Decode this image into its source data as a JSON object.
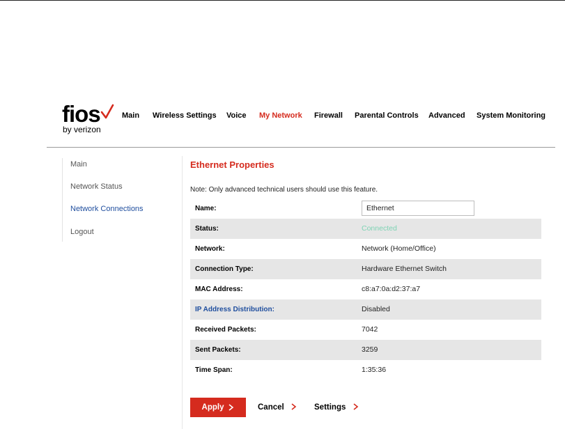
{
  "brand": {
    "logo_word": "fios",
    "logo_sub": "by verizon",
    "accent_color": "#d52b1e"
  },
  "top_nav": [
    {
      "label": "Main",
      "active": false
    },
    {
      "label": "Wireless Settings",
      "active": false
    },
    {
      "label": "Voice",
      "active": false
    },
    {
      "label": "My Network",
      "active": true
    },
    {
      "label": "Firewall",
      "active": false
    },
    {
      "label": "Parental Controls",
      "active": false
    },
    {
      "label": "Advanced",
      "active": false
    },
    {
      "label": "System Monitoring",
      "active": false
    }
  ],
  "sidebar": [
    {
      "label": "Main",
      "active": false
    },
    {
      "label": "Network Status",
      "active": false
    },
    {
      "label": "Network Connections",
      "active": true
    },
    {
      "label": "Logout",
      "active": false
    }
  ],
  "main": {
    "title": "Ethernet Properties",
    "note": "Note: Only advanced technical users should use this feature.",
    "name_label": "Name:",
    "name_value": "Ethernet",
    "rows": [
      {
        "label": "Status:",
        "value": "Connected"
      },
      {
        "label": "Network:",
        "value": "Network (Home/Office)"
      },
      {
        "label": "Connection Type:",
        "value": "Hardware Ethernet Switch"
      },
      {
        "label": "MAC Address:",
        "value": "c8:a7:0a:d2:37:a7"
      },
      {
        "label": "IP Address Distribution:",
        "value": "Disabled"
      },
      {
        "label": "Received Packets:",
        "value": "7042"
      },
      {
        "label": "Sent Packets:",
        "value": "3259"
      },
      {
        "label": "Time Span:",
        "value": "1:35:36"
      }
    ],
    "status_color": "#7ed3b4",
    "link_color": "#1f4e9e"
  },
  "actions": {
    "apply": "Apply",
    "cancel": "Cancel",
    "settings": "Settings"
  }
}
